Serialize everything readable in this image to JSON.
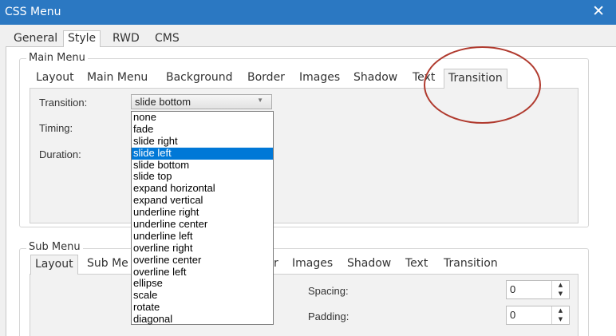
{
  "window": {
    "title": "CSS Menu",
    "close_glyph": "✕"
  },
  "top_tabs": [
    "General",
    "Style",
    "RWD",
    "CMS"
  ],
  "main_menu": {
    "legend": "Main Menu",
    "tabs": [
      "Layout",
      "Main Menu",
      "Background",
      "Border",
      "Images",
      "Shadow",
      "Text",
      "Transition"
    ],
    "active_tab": "Transition",
    "fields": {
      "transition": "Transition:",
      "timing": "Timing:",
      "duration": "Duration:"
    },
    "transition_value": "slide bottom",
    "options": [
      "none",
      "fade",
      "slide right",
      "slide left",
      "slide bottom",
      "slide top",
      "expand horizontal",
      "expand vertical",
      "underline right",
      "underline center",
      "underline left",
      "overline right",
      "overline center",
      "overline left",
      "ellipse",
      "scale",
      "rotate",
      "diagonal"
    ],
    "highlighted_option": "slide left"
  },
  "sub_menu": {
    "legend": "Sub Menu",
    "tabs": [
      "Layout",
      "Sub Me",
      "r",
      "Images",
      "Shadow",
      "Text",
      "Transition"
    ],
    "fields": {
      "spacing": "Spacing:",
      "padding": "Padding:"
    },
    "spacing_value": "0",
    "padding_value": "0"
  },
  "icons": {
    "close": "close-icon",
    "dropdown": "chevron-down-icon",
    "spin_up": "spin-up-icon",
    "spin_down": "spin-down-icon"
  },
  "colors": {
    "titlebar": "#2b78c2",
    "selection": "#0078d7",
    "annotation_circle": "#b03a2e"
  }
}
